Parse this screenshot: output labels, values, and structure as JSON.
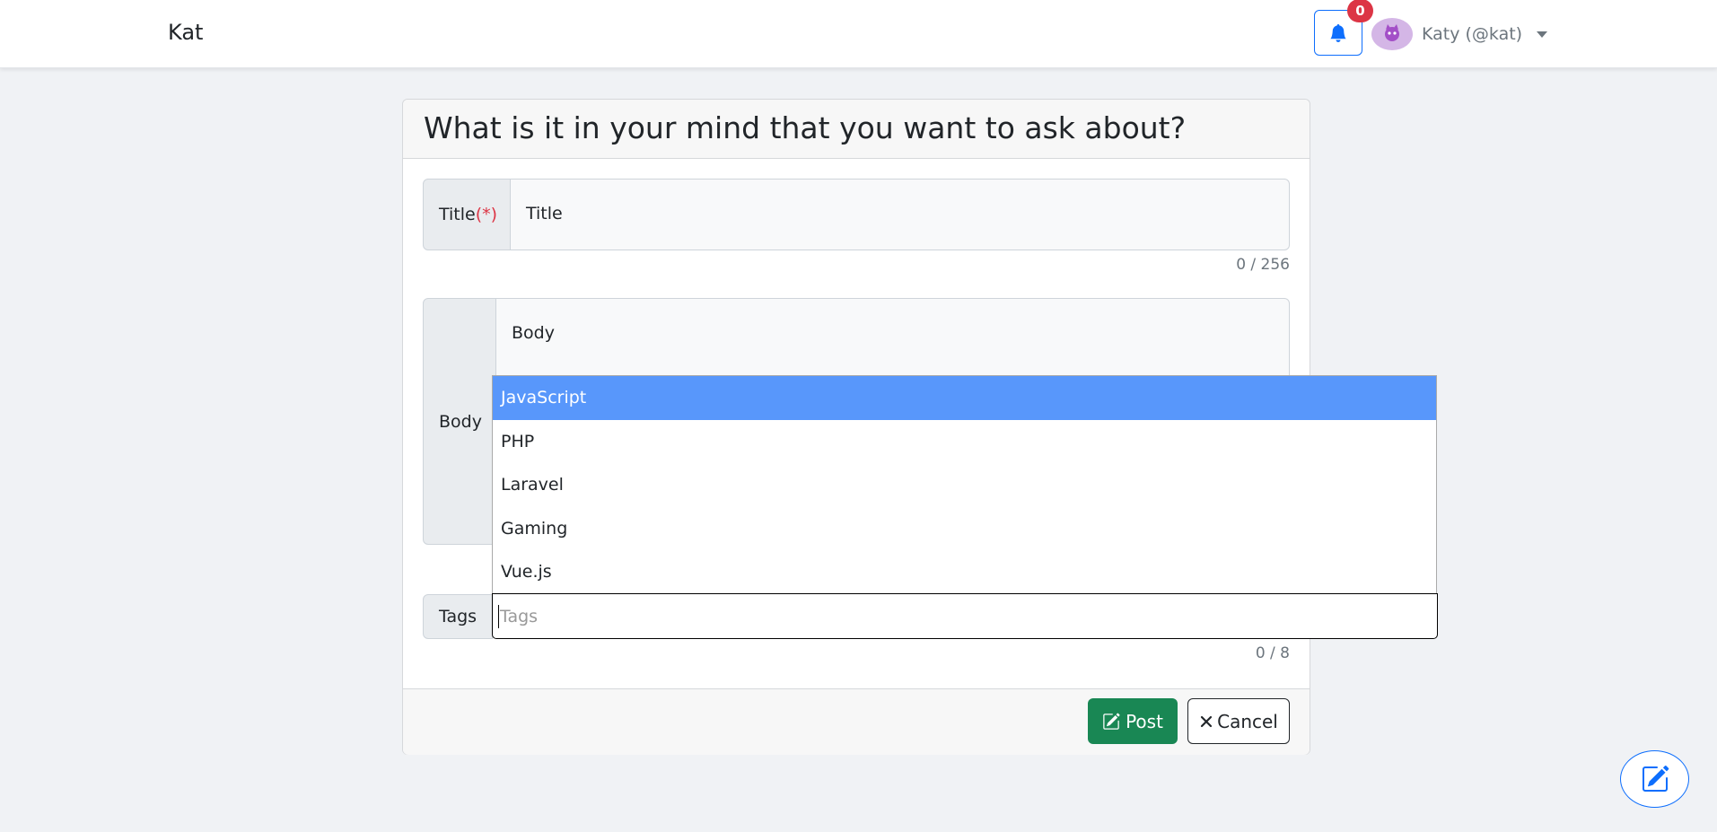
{
  "navbar": {
    "brand": "Kat",
    "notification_count": "0",
    "user_label": "Katy (@kat)",
    "icons": {
      "bell": "bell-icon",
      "avatar": "avatar",
      "caret": "caret-down-icon"
    }
  },
  "form": {
    "heading": "What is it in your mind that you want to ask about?",
    "title_label": "Title",
    "required_marker": "(*)",
    "title_placeholder": "Title",
    "title_counter": "0 / 256",
    "body_label": "Body",
    "body_placeholder": "Body",
    "tags_label": "Tags",
    "tags_placeholder": "Tags",
    "tags_counter": "0 / 8",
    "tag_options": [
      "JavaScript",
      "PHP",
      "Laravel",
      "Gaming",
      "Vue.js"
    ],
    "highlighted_option": "JavaScript"
  },
  "footer": {
    "post_label": "Post",
    "cancel_label": "Cancel"
  },
  "colors": {
    "primary": "#0d6efd",
    "success": "#198754",
    "danger": "#dc3545",
    "highlight": "#5897fb"
  }
}
